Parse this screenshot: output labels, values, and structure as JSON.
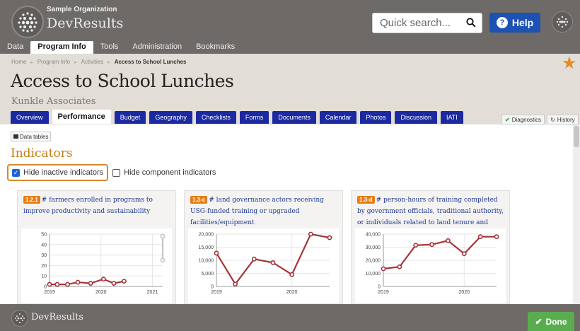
{
  "header": {
    "org_name": "Sample Organization",
    "app_name": "DevResults",
    "search_placeholder": "Quick search...",
    "help_label": "Help",
    "nav": [
      {
        "label": "Data",
        "active": false
      },
      {
        "label": "Program Info",
        "active": true
      },
      {
        "label": "Tools",
        "active": false
      },
      {
        "label": "Administration",
        "active": false
      },
      {
        "label": "Bookmarks",
        "active": false
      }
    ]
  },
  "breadcrumb": [
    "Home",
    "Program Info",
    "Activities",
    "Access to School Lunches"
  ],
  "page": {
    "title": "Access to School Lunches",
    "subtitle": "Kunkle Associates",
    "star_color": "#e98a22"
  },
  "tabs": [
    {
      "label": "Overview",
      "active": false
    },
    {
      "label": "Performance",
      "active": true
    },
    {
      "label": "Budget",
      "active": false
    },
    {
      "label": "Geography",
      "active": false
    },
    {
      "label": "Checklists",
      "active": false
    },
    {
      "label": "Forms",
      "active": false
    },
    {
      "label": "Documents",
      "active": false
    },
    {
      "label": "Calendar",
      "active": false
    },
    {
      "label": "Photos",
      "active": false
    },
    {
      "label": "Discussion",
      "active": false
    },
    {
      "label": "IATI",
      "active": false
    }
  ],
  "right_tabs": {
    "diagnostics": "Diagnostics",
    "history": "History"
  },
  "content": {
    "data_tables_label": "Data tables",
    "section_heading": "Indicators",
    "filter_inactive": {
      "label": "Hide inactive indicators",
      "checked": true
    },
    "filter_component": {
      "label": "Hide component indicators",
      "checked": false
    }
  },
  "indicators": [
    {
      "code": "1.2.1",
      "title": "# farmers enrolled in programs to improve productivity and sustainability"
    },
    {
      "code": "1.3-c",
      "title": "# land governance actors receiving USG-funded training or upgraded facilities/equipment"
    },
    {
      "code": "1.3-d",
      "title": "# person-hours of training completed by government officials, traditional authority, or individuals related to land tenure and"
    }
  ],
  "chart_data": [
    {
      "type": "line",
      "ylim": [
        0,
        50
      ],
      "yticks": [
        "0",
        "10",
        "20",
        "30",
        "40",
        "50"
      ],
      "xlim": [
        2019,
        2021.2
      ],
      "xticks": [
        {
          "v": 2019,
          "label": "2019"
        },
        {
          "v": 2020,
          "label": "2020"
        },
        {
          "v": 2021,
          "label": "2021"
        }
      ],
      "series": [
        {
          "color": "#a5343b",
          "x": [
            2019,
            2019.15,
            2019.35,
            2019.55,
            2019.8,
            2020.05,
            2020.25,
            2020.45
          ],
          "y": [
            2,
            2,
            2,
            4,
            3,
            7,
            3,
            5
          ]
        },
        {
          "color": "#c4c4c4",
          "x": [
            2021.2,
            2021.2
          ],
          "y": [
            48,
            25
          ]
        }
      ]
    },
    {
      "type": "line",
      "ylim": [
        0,
        22000
      ],
      "yticks": [
        "0",
        "5,000",
        "10,000",
        "15,000",
        "20,000"
      ],
      "xlim": [
        2019,
        2020.5
      ],
      "xticks": [
        {
          "v": 2019,
          "label": "2019"
        },
        {
          "v": 2020,
          "label": "2020"
        }
      ],
      "series": [
        {
          "color": "#a5343b",
          "x": [
            2019,
            2019.25,
            2019.5,
            2019.75,
            2020.0,
            2020.25,
            2020.5
          ],
          "y": [
            14000,
            1000,
            11500,
            10000,
            5000,
            22000,
            20500
          ]
        }
      ]
    },
    {
      "type": "line",
      "ylim": [
        0,
        40000
      ],
      "yticks": [
        "0",
        "10,000",
        "20,000",
        "30,000",
        "40,000"
      ],
      "xlim": [
        2019,
        2020.4
      ],
      "xticks": [
        {
          "v": 2019,
          "label": "2019"
        },
        {
          "v": 2020,
          "label": "2020"
        }
      ],
      "series": [
        {
          "color": "#a5343b",
          "x": [
            2019,
            2019.2,
            2019.4,
            2019.6,
            2019.8,
            2020.0,
            2020.2,
            2020.4
          ],
          "y": [
            13500,
            15000,
            31500,
            32000,
            35000,
            25000,
            38000,
            38000
          ]
        }
      ]
    }
  ],
  "footer": {
    "app_name": "DevResults",
    "done_label": "Done"
  }
}
